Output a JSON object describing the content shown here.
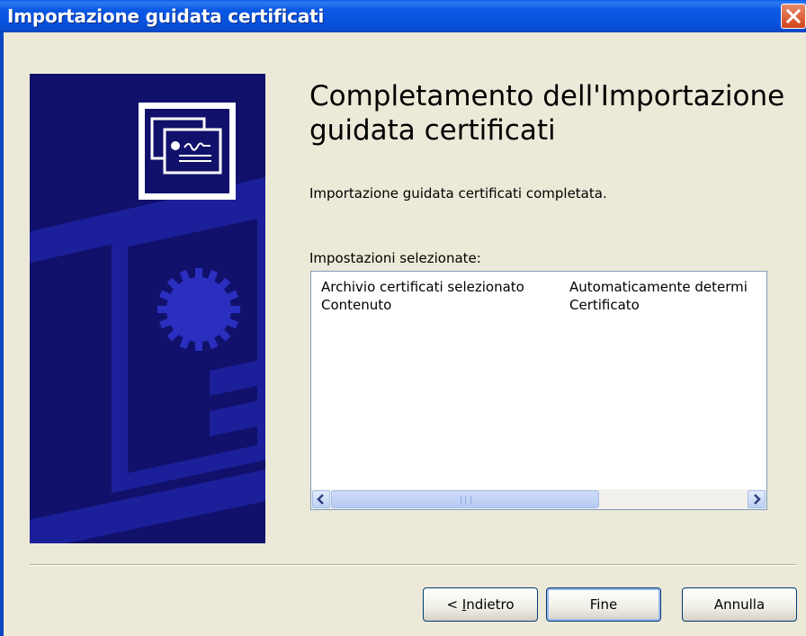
{
  "window": {
    "title": "Importazione guidata certificati"
  },
  "page": {
    "heading": "Completamento dell'Importazione guidata certificati",
    "message": "Importazione guidata certificati completata.",
    "settings_label": "Impostazioni selezionate:"
  },
  "settings": [
    {
      "name": "Archivio certificati selezionato",
      "value": "Automaticamente determi"
    },
    {
      "name": "Contenuto",
      "value": "Certificato"
    }
  ],
  "buttons": {
    "back_prefix": "< ",
    "back_mnemonic": "I",
    "back_rest": "ndietro",
    "finish": "Fine",
    "cancel": "Annulla"
  },
  "scrollbar": {
    "thumb_grip": "III"
  },
  "colors": {
    "titlebar": "#0852dd",
    "banner": "#11116c",
    "background": "#ece9d8",
    "close": "#d3431b"
  }
}
